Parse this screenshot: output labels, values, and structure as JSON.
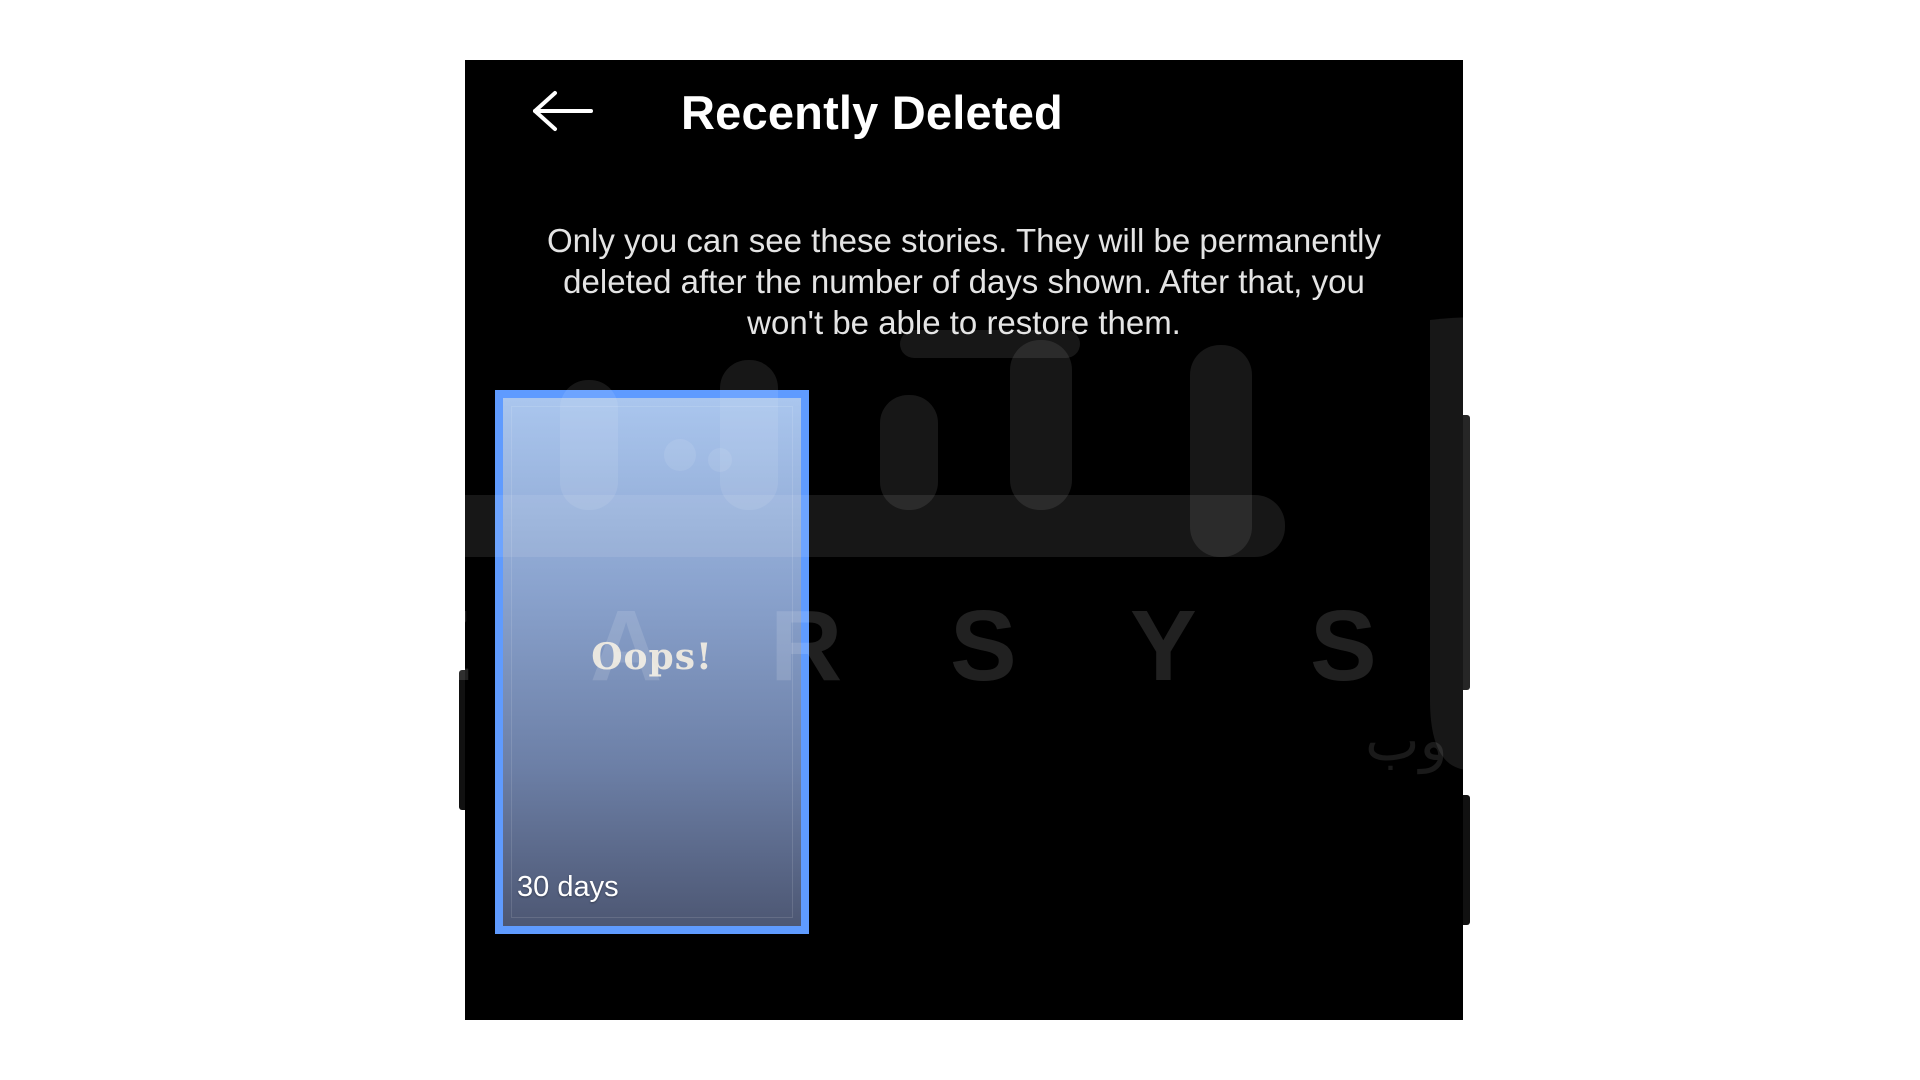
{
  "header": {
    "title": "Recently Deleted",
    "back_icon": "arrow-left-icon"
  },
  "description": "Only you can see these stories. They will be permanently deleted after the number of days shown. After that, you won't be able to restore them.",
  "stories": [
    {
      "text": "Oops!",
      "days_left": "30 days",
      "selected": true,
      "border_color": "#5f9bff"
    }
  ],
  "watermark": {
    "brand_latin": "A Z A R S Y S",
    "tagline_persian": "سرعت بی نهایت میزبانی وب"
  },
  "colors": {
    "screen_background": "#000000",
    "title_text": "#ffffff",
    "body_text": "#e4e4e4",
    "selection_border": "#5f9bff"
  }
}
